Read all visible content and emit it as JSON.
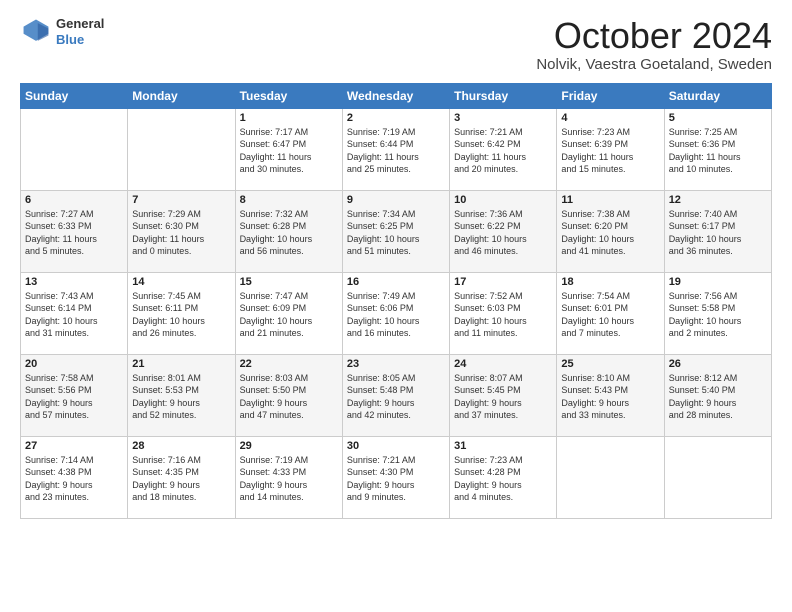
{
  "logo": {
    "general": "General",
    "blue": "Blue"
  },
  "header": {
    "title": "October 2024",
    "location": "Nolvik, Vaestra Goetaland, Sweden"
  },
  "weekdays": [
    "Sunday",
    "Monday",
    "Tuesday",
    "Wednesday",
    "Thursday",
    "Friday",
    "Saturday"
  ],
  "weeks": [
    [
      {
        "day": "",
        "info": ""
      },
      {
        "day": "",
        "info": ""
      },
      {
        "day": "1",
        "info": "Sunrise: 7:17 AM\nSunset: 6:47 PM\nDaylight: 11 hours\nand 30 minutes."
      },
      {
        "day": "2",
        "info": "Sunrise: 7:19 AM\nSunset: 6:44 PM\nDaylight: 11 hours\nand 25 minutes."
      },
      {
        "day": "3",
        "info": "Sunrise: 7:21 AM\nSunset: 6:42 PM\nDaylight: 11 hours\nand 20 minutes."
      },
      {
        "day": "4",
        "info": "Sunrise: 7:23 AM\nSunset: 6:39 PM\nDaylight: 11 hours\nand 15 minutes."
      },
      {
        "day": "5",
        "info": "Sunrise: 7:25 AM\nSunset: 6:36 PM\nDaylight: 11 hours\nand 10 minutes."
      }
    ],
    [
      {
        "day": "6",
        "info": "Sunrise: 7:27 AM\nSunset: 6:33 PM\nDaylight: 11 hours\nand 5 minutes."
      },
      {
        "day": "7",
        "info": "Sunrise: 7:29 AM\nSunset: 6:30 PM\nDaylight: 11 hours\nand 0 minutes."
      },
      {
        "day": "8",
        "info": "Sunrise: 7:32 AM\nSunset: 6:28 PM\nDaylight: 10 hours\nand 56 minutes."
      },
      {
        "day": "9",
        "info": "Sunrise: 7:34 AM\nSunset: 6:25 PM\nDaylight: 10 hours\nand 51 minutes."
      },
      {
        "day": "10",
        "info": "Sunrise: 7:36 AM\nSunset: 6:22 PM\nDaylight: 10 hours\nand 46 minutes."
      },
      {
        "day": "11",
        "info": "Sunrise: 7:38 AM\nSunset: 6:20 PM\nDaylight: 10 hours\nand 41 minutes."
      },
      {
        "day": "12",
        "info": "Sunrise: 7:40 AM\nSunset: 6:17 PM\nDaylight: 10 hours\nand 36 minutes."
      }
    ],
    [
      {
        "day": "13",
        "info": "Sunrise: 7:43 AM\nSunset: 6:14 PM\nDaylight: 10 hours\nand 31 minutes."
      },
      {
        "day": "14",
        "info": "Sunrise: 7:45 AM\nSunset: 6:11 PM\nDaylight: 10 hours\nand 26 minutes."
      },
      {
        "day": "15",
        "info": "Sunrise: 7:47 AM\nSunset: 6:09 PM\nDaylight: 10 hours\nand 21 minutes."
      },
      {
        "day": "16",
        "info": "Sunrise: 7:49 AM\nSunset: 6:06 PM\nDaylight: 10 hours\nand 16 minutes."
      },
      {
        "day": "17",
        "info": "Sunrise: 7:52 AM\nSunset: 6:03 PM\nDaylight: 10 hours\nand 11 minutes."
      },
      {
        "day": "18",
        "info": "Sunrise: 7:54 AM\nSunset: 6:01 PM\nDaylight: 10 hours\nand 7 minutes."
      },
      {
        "day": "19",
        "info": "Sunrise: 7:56 AM\nSunset: 5:58 PM\nDaylight: 10 hours\nand 2 minutes."
      }
    ],
    [
      {
        "day": "20",
        "info": "Sunrise: 7:58 AM\nSunset: 5:56 PM\nDaylight: 9 hours\nand 57 minutes."
      },
      {
        "day": "21",
        "info": "Sunrise: 8:01 AM\nSunset: 5:53 PM\nDaylight: 9 hours\nand 52 minutes."
      },
      {
        "day": "22",
        "info": "Sunrise: 8:03 AM\nSunset: 5:50 PM\nDaylight: 9 hours\nand 47 minutes."
      },
      {
        "day": "23",
        "info": "Sunrise: 8:05 AM\nSunset: 5:48 PM\nDaylight: 9 hours\nand 42 minutes."
      },
      {
        "day": "24",
        "info": "Sunrise: 8:07 AM\nSunset: 5:45 PM\nDaylight: 9 hours\nand 37 minutes."
      },
      {
        "day": "25",
        "info": "Sunrise: 8:10 AM\nSunset: 5:43 PM\nDaylight: 9 hours\nand 33 minutes."
      },
      {
        "day": "26",
        "info": "Sunrise: 8:12 AM\nSunset: 5:40 PM\nDaylight: 9 hours\nand 28 minutes."
      }
    ],
    [
      {
        "day": "27",
        "info": "Sunrise: 7:14 AM\nSunset: 4:38 PM\nDaylight: 9 hours\nand 23 minutes."
      },
      {
        "day": "28",
        "info": "Sunrise: 7:16 AM\nSunset: 4:35 PM\nDaylight: 9 hours\nand 18 minutes."
      },
      {
        "day": "29",
        "info": "Sunrise: 7:19 AM\nSunset: 4:33 PM\nDaylight: 9 hours\nand 14 minutes."
      },
      {
        "day": "30",
        "info": "Sunrise: 7:21 AM\nSunset: 4:30 PM\nDaylight: 9 hours\nand 9 minutes."
      },
      {
        "day": "31",
        "info": "Sunrise: 7:23 AM\nSunset: 4:28 PM\nDaylight: 9 hours\nand 4 minutes."
      },
      {
        "day": "",
        "info": ""
      },
      {
        "day": "",
        "info": ""
      }
    ]
  ]
}
